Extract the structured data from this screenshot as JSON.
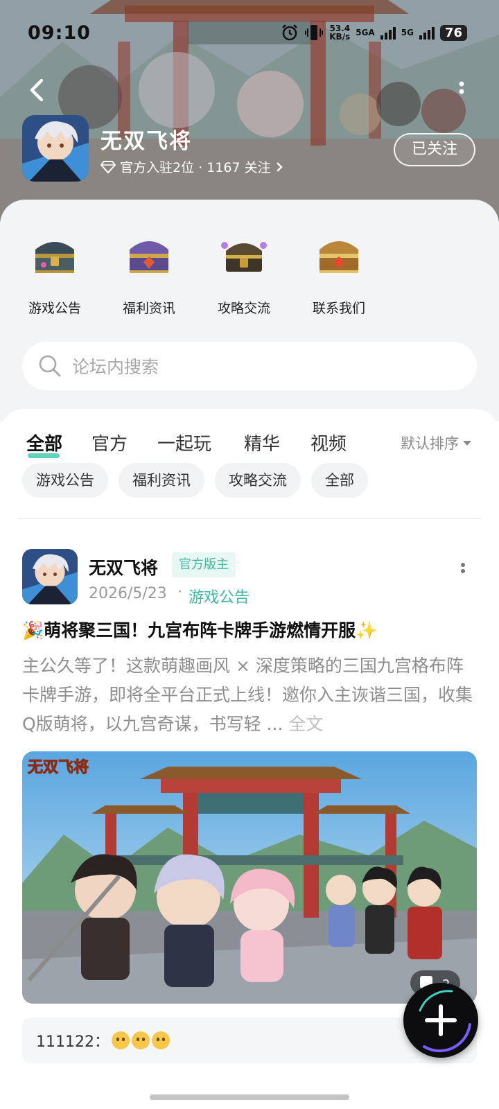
{
  "status_bar": {
    "time": "09:10",
    "net_speed_value": "53.4",
    "net_speed_unit": "KB/s",
    "network_1": "5GA",
    "network_2": "5G",
    "battery": "76",
    "icons": [
      "alarm-icon",
      "vibrate-icon"
    ]
  },
  "header": {
    "game_title": "无双飞将",
    "meta": "官方入驻2位 · 1167 关注",
    "meta_icon": "diamond-icon",
    "follow_button": "已关注"
  },
  "quick_links": [
    {
      "label": "游戏公告",
      "icon": "treasure-chest-icon"
    },
    {
      "label": "福利资讯",
      "icon": "purple-chest-icon"
    },
    {
      "label": "攻略交流",
      "icon": "jeweled-chest-icon"
    },
    {
      "label": "联系我们",
      "icon": "golden-chest-icon"
    }
  ],
  "search": {
    "placeholder": "论坛内搜索"
  },
  "tabs": {
    "items": [
      "全部",
      "官方",
      "一起玩",
      "精华",
      "视频"
    ],
    "active": "全部",
    "sort_label": "默认排序"
  },
  "chips": [
    "游戏公告",
    "福利资讯",
    "攻略交流",
    "全部"
  ],
  "post": {
    "author": "无双飞将",
    "badge": "官方版主",
    "date": "2026/5/23",
    "separator": "·",
    "category": "游戏公告",
    "title": "🎉萌将聚三国！九宫布阵卡牌手游燃情开服✨",
    "body": "主公久等了！这款萌趣画风 × 深度策略的三国九宫格布阵卡牌手游，即将全平台正式上线！邀你入主诙谐三国，收集Q版萌将，以九宫奇谋，书写轻 ...",
    "full_text_link": "全文",
    "image_logo": "无双飞将",
    "image_badge": "2"
  },
  "comment": {
    "text": "111122：",
    "emoji_count": 3
  },
  "colors": {
    "accent": "#3db9a0",
    "badge_bg": "#e8f7f3",
    "chip_bg": "#f2f3f5"
  }
}
